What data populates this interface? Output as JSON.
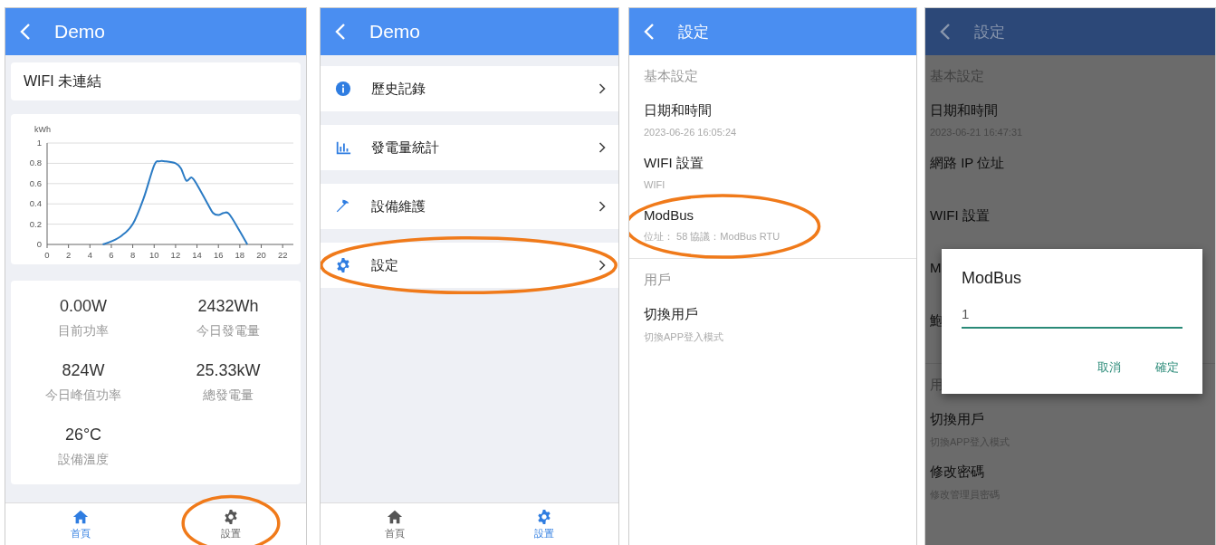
{
  "screens": [
    {
      "kind": "home",
      "header": {
        "title": "Demo"
      },
      "wifi_status": "WIFI 未連結",
      "chart_data": {
        "type": "line",
        "ylabel": "kWh",
        "x": [
          5.2,
          6,
          7,
          8,
          9,
          10,
          10.5,
          11,
          12,
          12.5,
          13,
          13.5,
          14,
          15,
          15.5,
          16,
          16.5,
          17,
          18,
          18.7
        ],
        "series": [
          {
            "color": "#2b7bc4",
            "values": [
              0,
              0.03,
              0.09,
              0.2,
              0.45,
              0.78,
              0.82,
              0.82,
              0.8,
              0.75,
              0.63,
              0.66,
              0.59,
              0.4,
              0.31,
              0.29,
              0.31,
              0.3,
              0.13,
              0
            ]
          }
        ],
        "grid": true,
        "xlim": [
          0,
          23
        ],
        "ylim": [
          0,
          1
        ],
        "xticks": [
          0,
          2,
          4,
          6,
          8,
          10,
          12,
          14,
          16,
          18,
          20,
          22
        ],
        "yticks": [
          0,
          0.2,
          0.4,
          0.6,
          0.8,
          1
        ]
      },
      "stats": [
        {
          "value": "0.00W",
          "label": "目前功率"
        },
        {
          "value": "2432Wh",
          "label": "今日發電量"
        },
        {
          "value": "824W",
          "label": "今日峰值功率"
        },
        {
          "value": "25.33kW",
          "label": "總發電量"
        },
        {
          "value": "26°C",
          "label": "設備溫度"
        }
      ],
      "bottom_nav": [
        {
          "kind": "home",
          "label": "首頁",
          "selected": true,
          "circled": false
        },
        {
          "kind": "gear",
          "label": "設置",
          "selected": false,
          "circled": true
        }
      ]
    },
    {
      "kind": "menu",
      "header": {
        "title": "Demo"
      },
      "menu": [
        {
          "kind": "info",
          "label": "歷史記錄",
          "circled": false
        },
        {
          "kind": "chart",
          "label": "發電量統計",
          "circled": false
        },
        {
          "kind": "tool",
          "label": "設備維護",
          "circled": false
        },
        {
          "kind": "gear",
          "label": "設定",
          "circled": true
        }
      ],
      "bottom_nav": [
        {
          "kind": "home",
          "label": "首頁",
          "selected": false,
          "circled": false
        },
        {
          "kind": "gear",
          "label": "設置",
          "selected": true,
          "circled": false
        }
      ]
    },
    {
      "kind": "settings",
      "header": {
        "title": "設定"
      },
      "sections": [
        {
          "heading": "基本設定",
          "items": [
            {
              "title": "日期和時間",
              "subtitle": "2023-06-26 16:05:24",
              "circled": false
            },
            {
              "title": "WIFI 設置",
              "subtitle": "WIFI",
              "circled": false
            },
            {
              "title": "ModBus",
              "subtitle": "位址： 58   協議：ModBus RTU",
              "circled": true
            }
          ]
        },
        {
          "heading": "用戶",
          "items": [
            {
              "title": "切換用戶",
              "subtitle": "切換APP登入模式",
              "circled": false
            }
          ]
        }
      ]
    },
    {
      "kind": "settings",
      "header": {
        "title": "設定"
      },
      "sections": [
        {
          "heading": "基本設定",
          "items": [
            {
              "title": "日期和時間",
              "subtitle": "2023-06-21 16:47:31",
              "circled": false
            },
            {
              "title": "網路 IP 位址",
              "circled": false
            },
            {
              "title": "WIFI 設置",
              "circled": false
            },
            {
              "title": "M",
              "circled": false
            },
            {
              "title": "鮑",
              "circled": false
            }
          ]
        },
        {
          "heading": "用",
          "items": [
            {
              "title": "切換用戶",
              "subtitle": "切換APP登入模式",
              "circled": false
            },
            {
              "title": "修改密碼",
              "subtitle": "修改管理員密碼",
              "circled": false
            }
          ]
        }
      ],
      "dialog": {
        "title": "ModBus",
        "value": "1",
        "buttons": [
          "取消",
          "確定"
        ]
      }
    }
  ]
}
